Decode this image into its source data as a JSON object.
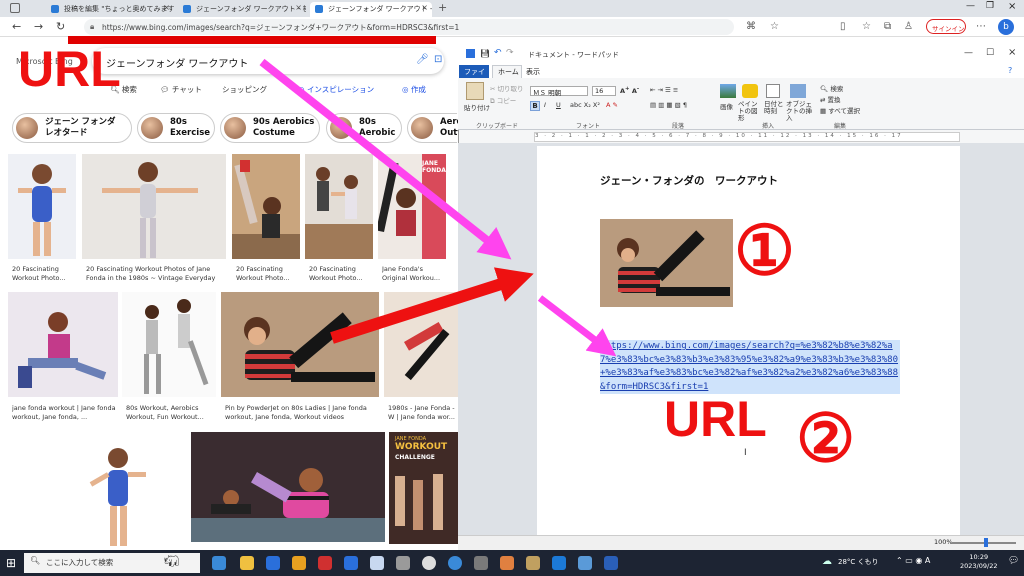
{
  "browser": {
    "tabs": [
      {
        "label": "投稿を編集 \"ちょっと奥めてみます"
      },
      {
        "label": "ジェーンフォンダ ワークアウト - 検索"
      },
      {
        "label": "ジェーンフォンダ ワークアウト - Bing im"
      }
    ],
    "address": "https://www.bing.com/images/search?q=ジェーンフォンダ+ワークアウト&form=HDRSC3&first=1",
    "signin_label": "サインイン"
  },
  "bing": {
    "logo": "Microsoft Bing",
    "query": "ジェーンフォンダ ワークアウト",
    "nav": [
      "検索",
      "チャット",
      "ショッピング",
      "インスピレーション",
      "作成"
    ],
    "chips": [
      {
        "line1": "ジェーン フォンダ",
        "line2": "レオタード"
      },
      {
        "line1": "80s",
        "line2": "Exercise"
      },
      {
        "line1": "90s Aerobics",
        "line2": "Costume"
      },
      {
        "line1": "80s",
        "line2": "Aerobic"
      },
      {
        "line1": "Aero",
        "line2": "Outf"
      }
    ],
    "captions": [
      "20 Fascinating Workout Photo...",
      "20 Fascinating Workout Photos of Jane Fonda in the 1980s ~ Vintage Everyday",
      "20 Fascinating Workout Photo...",
      "20 Fascinating Workout Photo...",
      "Jane Fonda's Original Workou...",
      "jane fonda workout | Jane fonda workout, Jane fonda, ...",
      "80s Workout, Aerobics Workout, Fun Workout...",
      "Pin by PowderJet on 80s Ladies | Jane fonda workout, Jane fonda, Workout videos",
      "1980s - Jane Fonda - W | Jane fonda wor..."
    ],
    "banner_text": "JANE FONDA",
    "workout_text": "WORKOUT",
    "challenge_text": "CHALLENGE"
  },
  "wordpad": {
    "title": "ドキュメント - ワードパッド",
    "menu": {
      "file": "ファイル",
      "home": "ホーム",
      "view": "表示"
    },
    "font_name": "ＭＳ 明朝",
    "font_size": "16",
    "groups": [
      "クリップボード",
      "フォント",
      "段落",
      "挿入",
      "編集"
    ],
    "buttons": {
      "paste": "貼り付け",
      "cut": "切り取り",
      "copy": "コピー",
      "picture": "画像",
      "paint": "ペイントの図形",
      "datetime": "日付と時刻",
      "object": "オブジェクトの挿入",
      "find": "検索",
      "replace": "置換",
      "selectall": "すべて選択"
    },
    "ruler": "3 · 2 · 1 · 1 · 2 · 3 · 4 · 5 · 6 · 7 · 8 · 9 · 10 · 11 · 12 · 13 · 14 · 15 · 16 · 17",
    "doc_title": "ジェーン・フォンダの　ワークアウト",
    "doc_url": "https://www.bing.com/images/search?q=%e3%82%b8%e3%82%a7%e3%83%bc%e3%83%b3%e3%83%95%e3%82%a9%e3%83%b3%e3%83%80+%e3%83%af%e3%83%bc%e3%82%af%e3%82%a2%e3%82%a6%e3%83%88&form=HDRSC3&first=1",
    "zoom": "100%"
  },
  "annotations": {
    "url_label_top": "URL",
    "url_label_bottom": "URL",
    "circle_one": "①",
    "circle_two": "②",
    "red": "#ee1111",
    "magenta": "#ff44ee"
  },
  "taskbar": {
    "search_placeholder": "ここに入力して検索",
    "weather": "28°C くもり",
    "time": "10:29",
    "date": "2023/09/22"
  }
}
